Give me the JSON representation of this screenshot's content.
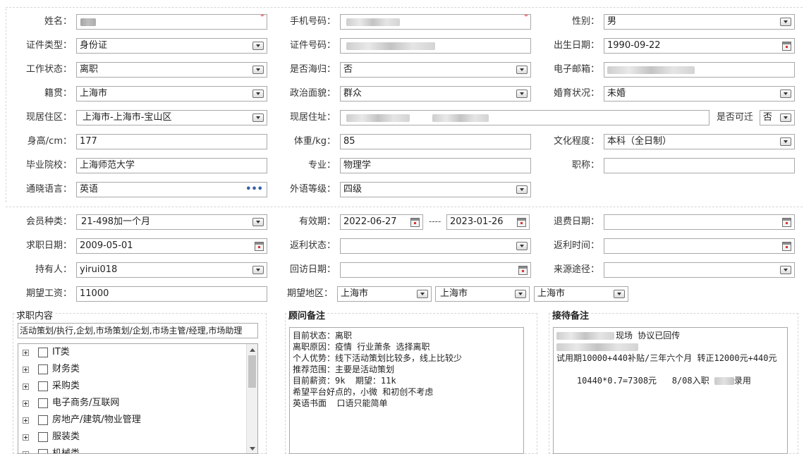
{
  "basic": {
    "name": {
      "label": "姓名：",
      "value": ""
    },
    "phone": {
      "label": "手机号码：",
      "value": ""
    },
    "gender": {
      "label": "性别：",
      "value": "男"
    },
    "id_type": {
      "label": "证件类型：",
      "value": "身份证"
    },
    "id_number": {
      "label": "证件号码：",
      "value": ""
    },
    "birth_date": {
      "label": "出生日期：",
      "value": "1990-09-22"
    },
    "work_status": {
      "label": "工作状态：",
      "value": "离职"
    },
    "overseas": {
      "label": "是否海归：",
      "value": "否"
    },
    "email": {
      "label": "电子邮箱：",
      "value": ""
    },
    "native_place": {
      "label": "籍贯：",
      "value": "上海市"
    },
    "political": {
      "label": "政治面貌：",
      "value": "群众"
    },
    "marital": {
      "label": "婚育状况：",
      "value": "未婚"
    },
    "residence_area": {
      "label": "现居住区：",
      "value": "上海市-上海市-宝山区"
    },
    "residence_address": {
      "label": "现居住址：",
      "value": ""
    },
    "relocate": {
      "label": "是否可迁",
      "value": "否"
    },
    "height": {
      "label": "身高/cm：",
      "value": "177"
    },
    "weight": {
      "label": "体重/kg：",
      "value": "85"
    },
    "education": {
      "label": "文化程度：",
      "value": "本科（全日制）"
    },
    "school": {
      "label": "毕业院校：",
      "value": "上海师范大学"
    },
    "major": {
      "label": "专业：",
      "value": "物理学"
    },
    "title": {
      "label": "职称：",
      "value": ""
    },
    "languages": {
      "label": "通晓语言：",
      "value": "英语",
      "more": "•••"
    },
    "foreign_level": {
      "label": "外语等级：",
      "value": "四级"
    }
  },
  "member": {
    "member_type": {
      "label": "会员种类：",
      "value": "21-498加一个月"
    },
    "validity": {
      "label": "有效期：",
      "from": "2022-06-27",
      "separator": "----",
      "to": "2023-01-26"
    },
    "refund_date": {
      "label": "退费日期：",
      "value": ""
    },
    "job_search_date": {
      "label": "求职日期：",
      "value": "2009-05-01"
    },
    "rebate_status": {
      "label": "返利状态：",
      "value": ""
    },
    "rebate_time": {
      "label": "返利时间：",
      "value": ""
    },
    "holder": {
      "label": "持有人：",
      "value": "yirui018"
    },
    "visit_date": {
      "label": "回访日期：",
      "value": ""
    },
    "source": {
      "label": "来源途径：",
      "value": ""
    },
    "expected_salary": {
      "label": "期望工资：",
      "value": "11000"
    },
    "expected_region": {
      "label": "期望地区：",
      "province": "上海市",
      "city": "上海市",
      "district": "上海市"
    }
  },
  "job_content": {
    "title": "求职内容",
    "selected": "活动策划/执行,企划,市场策划/企划,市场主管/经理,市场助理",
    "tree": [
      "IT类",
      "财务类",
      "采购类",
      "电子商务/互联网",
      "房地产/建筑/物业管理",
      "服装类",
      "机械类"
    ]
  },
  "advisor_notes": {
    "title": "顾问备注",
    "text": "目前状态：离职\n离职原因：疫情 行业萧条 选择离职\n个人优势：线下活动策划比较多，线上比较少\n推荐范围：主要是活动策划\n目前薪资：9k  期望：11k\n希望平台好点的，小微 和初创不考虑\n英语书面  口语只能简单"
  },
  "reception_notes": {
    "title": "接待备注",
    "line1": "现场 协议已回传",
    "line2": "",
    "line3": "试用期10000+440补贴/三年六个月 转正12000元+440元",
    "line4a": "10440*0.7=7308元   8/08入职 ",
    "line4b": "录用"
  }
}
